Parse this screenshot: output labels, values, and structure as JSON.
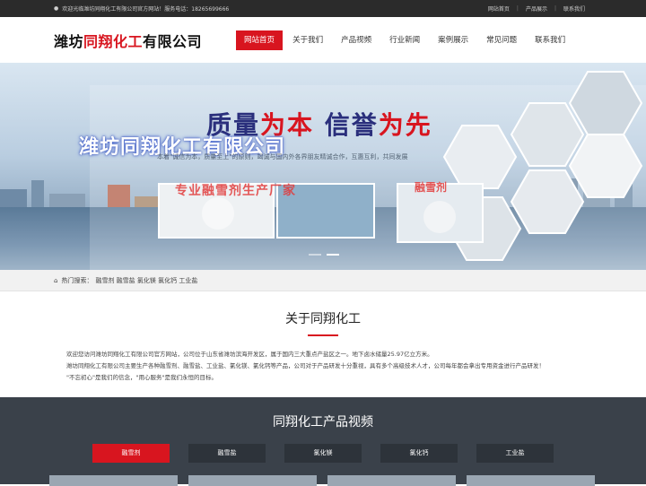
{
  "topbar": {
    "welcome": "欢迎光临潍坊同翔化工有限公司官方网站！服务电话：18265699666",
    "links": [
      "网站首页",
      "产品展示",
      "联系我们"
    ]
  },
  "header": {
    "logo_prefix": "潍坊",
    "logo_red": "同翔化工",
    "logo_suffix": "有限公司",
    "nav": [
      "网站首页",
      "关于我们",
      "产品视频",
      "行业新闻",
      "案例展示",
      "常见问题",
      "联系我们"
    ]
  },
  "banner": {
    "slogan_a": "质量",
    "slogan_b": "为本",
    "slogan_c": "信誉",
    "slogan_d": "为先",
    "company": "潍坊同翔化工有限公司",
    "subline": "本着\"诚信为本，质量至上\"的原则，竭诚与国内外各界朋友精诚合作，互惠互利，共同发展",
    "product_line": "专业融雪剂生产厂家",
    "product_badge": "融雪剂"
  },
  "hotsearch": {
    "label": "热门搜索：",
    "keywords": "融雪剂 融雪盐 氯化镁 氯化钙 工业盐"
  },
  "about": {
    "title": "关于同翔化工",
    "p1": "欢迎您访问潍坊同翔化工有限公司官方网站，公司位于山东省潍坊滨海开发区，属于国内三大重点产盐区之一。地下卤水储量25.97亿立方米。",
    "p2": "潍坊同翔化工有限公司主要生产各种融雪剂、融雪盐、工业盐、氯化镁、氯化钙等产品，公司对于产品研发十分重视，具有多个高级技术人才，公司每年都会拿出专用资金进行产品研发！",
    "p3": "\"不忘初心\"是我们的信念，\"用心服务\"是我们永恒的目标。"
  },
  "products": {
    "title": "同翔化工产品视频",
    "tabs": [
      "融雪剂",
      "融雪盐",
      "氯化镁",
      "氯化钙",
      "工业盐"
    ]
  },
  "colors": {
    "accent": "#d8151f",
    "dark": "#3a414a"
  }
}
